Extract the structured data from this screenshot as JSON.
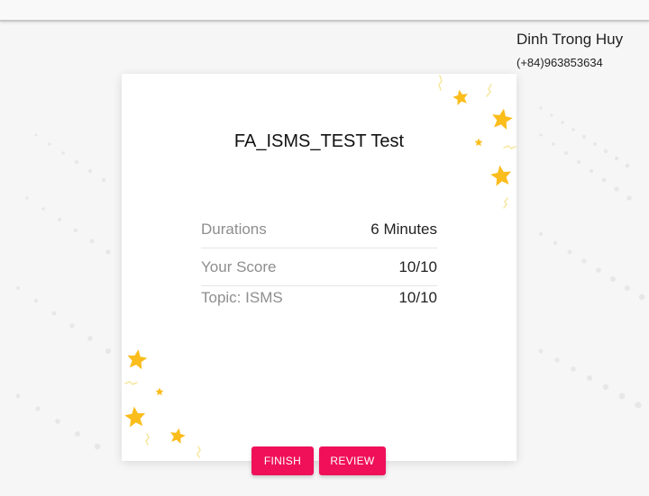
{
  "user": {
    "name": "Dinh Trong Huy",
    "phone": "(+84)963853634"
  },
  "test": {
    "title": "FA_ISMS_TEST Test"
  },
  "results": [
    {
      "label": "Durations",
      "value": "6 Minutes"
    },
    {
      "label": "Your Score",
      "value": "10/10"
    },
    {
      "label": "Topic: ISMS",
      "value": "10/10"
    }
  ],
  "actions": {
    "finish_label": "FINISH",
    "review_label": "REVIEW"
  },
  "colors": {
    "accent": "#f0105a",
    "star": "#fbbd1c"
  }
}
